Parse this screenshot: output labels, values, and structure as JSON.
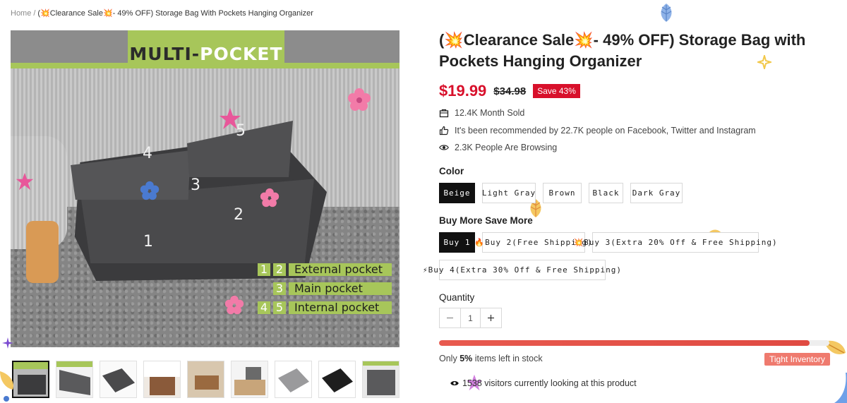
{
  "breadcrumb": {
    "home": "Home",
    "separator": "/",
    "current": "(💥Clearance Sale💥- 49% OFF) Storage Bag With Pockets Hanging Organizer"
  },
  "gallery": {
    "banner_left": "MULTI-",
    "banner_right": "POCKET",
    "pocket_numbers": [
      "1",
      "2",
      "3",
      "4",
      "5"
    ],
    "legend": [
      {
        "nums": [
          "1",
          "2"
        ],
        "label": "External pocket"
      },
      {
        "nums": [
          "3"
        ],
        "label": "Main pocket"
      },
      {
        "nums": [
          "4",
          "5"
        ],
        "label": "Internal pocket"
      }
    ],
    "thumbnail_count": 9
  },
  "product": {
    "title": "(💥Clearance Sale💥- 49% OFF) Storage Bag with Pockets Hanging Organizer",
    "price": "$19.99",
    "compare_price": "$34.98",
    "save_badge": "Save 43%"
  },
  "info": {
    "sold": "12.4K Month Sold",
    "recommended": "It's been recommended by 22.7K people on Facebook, Twitter and Instagram",
    "browsing": "2.3K People Are Browsing"
  },
  "color": {
    "label": "Color",
    "options": [
      "Beige",
      "Light Gray",
      "Brown",
      "Black",
      "Dark Gray"
    ],
    "selected": "Beige"
  },
  "bundle": {
    "label": "Buy More Save More",
    "options": [
      "Buy 1",
      "🔥Buy 2(Free Shipping)",
      "💥Buy 3(Extra 20% Off & Free Shipping)",
      "⚡Buy 4(Extra 30% Off & Free Shipping)"
    ],
    "selected": "Buy 1"
  },
  "quantity": {
    "label": "Quantity",
    "value": "1"
  },
  "stock": {
    "prefix": "Only",
    "percent": "5%",
    "suffix": "items left in stock",
    "bar_fill_fraction": 0.95,
    "badge": "Tight Inventory"
  },
  "visitors": {
    "text": "1538 visitors currently looking at this product"
  },
  "colors": {
    "price_red": "#d8102b",
    "stock_bar": "#e85a4f",
    "tight_badge": "#ef7a6e",
    "banner_green": "#a7c65a"
  }
}
